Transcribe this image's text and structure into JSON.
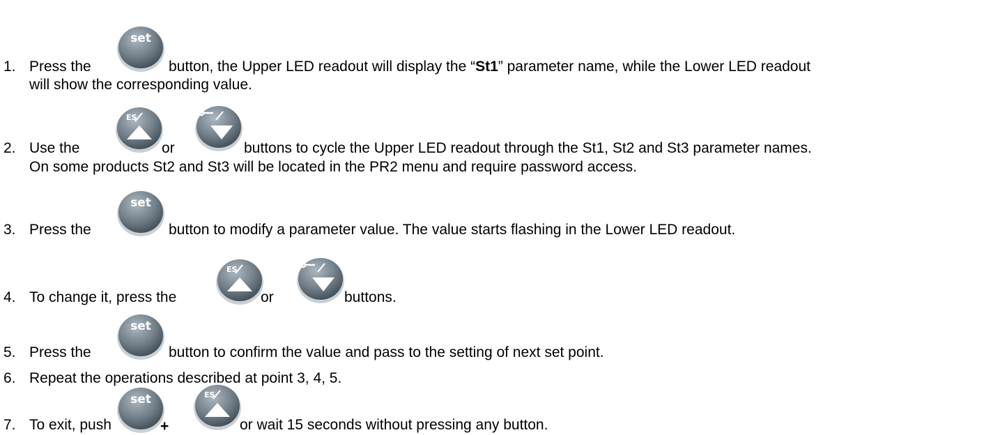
{
  "steps": [
    {
      "number": "1.",
      "parts": [
        "Press the ",
        " button, the Upper LED readout will display the “",
        "St1",
        "” parameter name, while the Lower LED readout"
      ],
      "line2": "will show the corresponding value."
    },
    {
      "number": "2.",
      "parts": [
        "Use the ",
        " or ",
        " buttons to cycle the Upper LED readout through the St1, St2 and St3 parameter names."
      ],
      "line2": "On some products St2 and St3 will be located in the PR2 menu and require password access."
    },
    {
      "number": "3.",
      "parts": [
        "Press the ",
        " button to modify a parameter value. The value starts flashing in the Lower LED readout."
      ]
    },
    {
      "number": "4.",
      "parts": [
        "To change it, press the ",
        " or ",
        " buttons."
      ]
    },
    {
      "number": "5.",
      "parts": [
        "Press the ",
        " button to confirm the value and pass to the setting of next set point."
      ]
    },
    {
      "number": "6.",
      "text": "Repeat the operations described at point 3, 4, 5."
    },
    {
      "number": "7.",
      "parts": [
        "To exit, push ",
        " + ",
        " or wait 15 seconds without pressing any button."
      ]
    }
  ],
  "button_labels": {
    "set": "set",
    "up": "ES"
  },
  "colors": {
    "button_dark": "#4a5560",
    "button_mid": "#8c98a2",
    "button_light": "#cfd6db",
    "arrow": "#ffffff"
  }
}
